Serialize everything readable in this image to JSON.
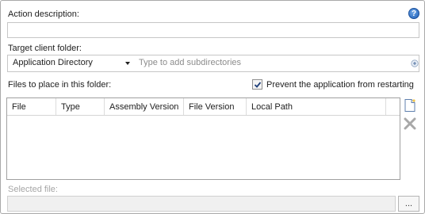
{
  "action": {
    "label": "Action description:",
    "value": "",
    "help_icon": "help-icon"
  },
  "target": {
    "label": "Target client folder:",
    "folder_selected": "Application Directory",
    "subdir_placeholder": "Type to add subdirectories"
  },
  "files": {
    "label": "Files to place in this folder:",
    "prevent_restart_label": "Prevent the application from restarting",
    "prevent_restart_checked": true,
    "columns": [
      "File",
      "Type",
      "Assembly Version",
      "File Version",
      "Local Path"
    ],
    "rows": []
  },
  "selected_file": {
    "label": "Selected file:",
    "value": "",
    "browse_label": "..."
  },
  "colors": {
    "accent": "#1d5fb8",
    "delete_icon": "#a8a8a8"
  }
}
